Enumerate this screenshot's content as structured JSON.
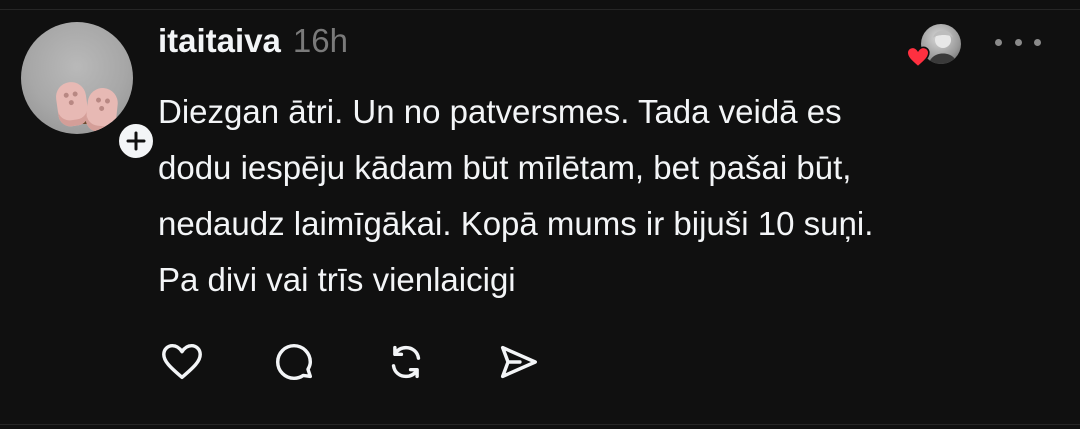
{
  "post": {
    "username": "itaitaiva",
    "timestamp": "16h",
    "body": "Diezgan ātri. Un no patversmes. Tada veidā es\ndodu iespēju kādam būt mīlētam, bet pašai būt,\nnedaudz laimīgākai. Kopā mums ir bijuši 10 suņi.\nPa divi vai trīs vienlaicigi"
  },
  "icons": {
    "follow": "plus-icon",
    "liked_by": "heart-icon",
    "more": "more-dots-icon",
    "like": "heart-outline-icon",
    "reply": "comment-bubble-icon",
    "repost": "repost-icon",
    "share": "send-icon"
  },
  "colors": {
    "background": "#101010",
    "text": "#f3f5f7",
    "secondary_text": "#7a7a7a",
    "heart": "#ff3040"
  }
}
